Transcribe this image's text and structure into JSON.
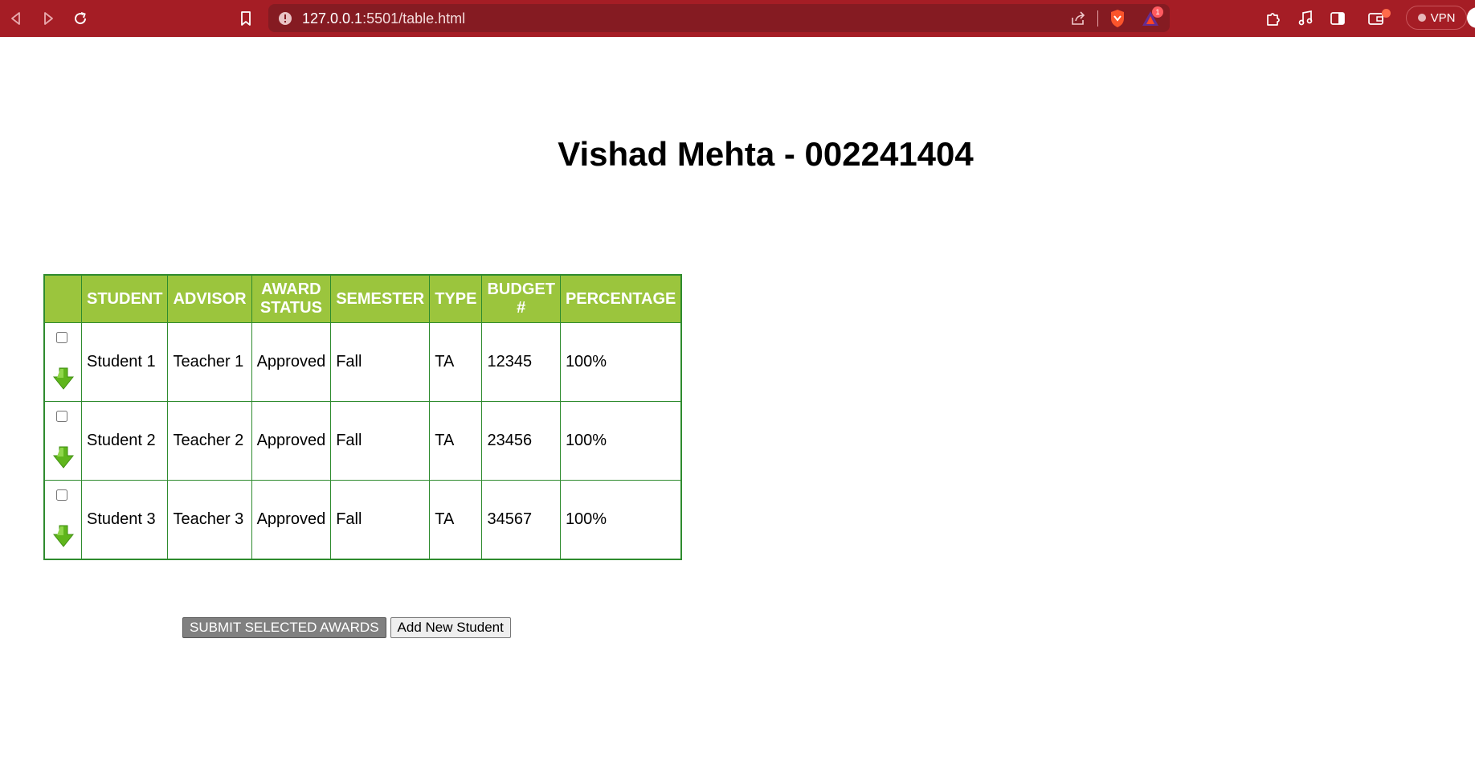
{
  "browser": {
    "url_host": "127.0.0.1",
    "url_rest": ":5501/table.html",
    "rewards_badge": "1",
    "vpn_label": "VPN",
    "theme_color": "#a51d25"
  },
  "page": {
    "title": "Vishad Mehta - 002241404"
  },
  "table": {
    "headers": {
      "select": "",
      "student": "STUDENT",
      "advisor": "ADVISOR",
      "award_status": "AWARD STATUS",
      "semester": "SEMESTER",
      "type": "TYPE",
      "budget": "BUDGET #",
      "percentage": "PERCENTAGE"
    },
    "rows": [
      {
        "student": "Student 1",
        "advisor": "Teacher 1",
        "award_status": "Approved",
        "semester": "Fall",
        "type": "TA",
        "budget": "12345",
        "percentage": "100%",
        "checked": false
      },
      {
        "student": "Student 2",
        "advisor": "Teacher 2",
        "award_status": "Approved",
        "semester": "Fall",
        "type": "TA",
        "budget": "23456",
        "percentage": "100%",
        "checked": false
      },
      {
        "student": "Student 3",
        "advisor": "Teacher 3",
        "award_status": "Approved",
        "semester": "Fall",
        "type": "TA",
        "budget": "34567",
        "percentage": "100%",
        "checked": false
      }
    ],
    "header_color": "#9bc53d",
    "border_color": "#2e8b2e"
  },
  "buttons": {
    "submit_label": "SUBMIT SELECTED AWARDS",
    "add_label": "Add New Student"
  },
  "icons": [
    "back-icon",
    "forward-icon",
    "reload-icon",
    "bookmark-icon",
    "site-info-icon",
    "share-icon",
    "brave-shields-icon",
    "brave-rewards-icon",
    "extensions-icon",
    "media-icon",
    "sidebar-icon",
    "wallet-icon",
    "expand-arrow-icon"
  ]
}
